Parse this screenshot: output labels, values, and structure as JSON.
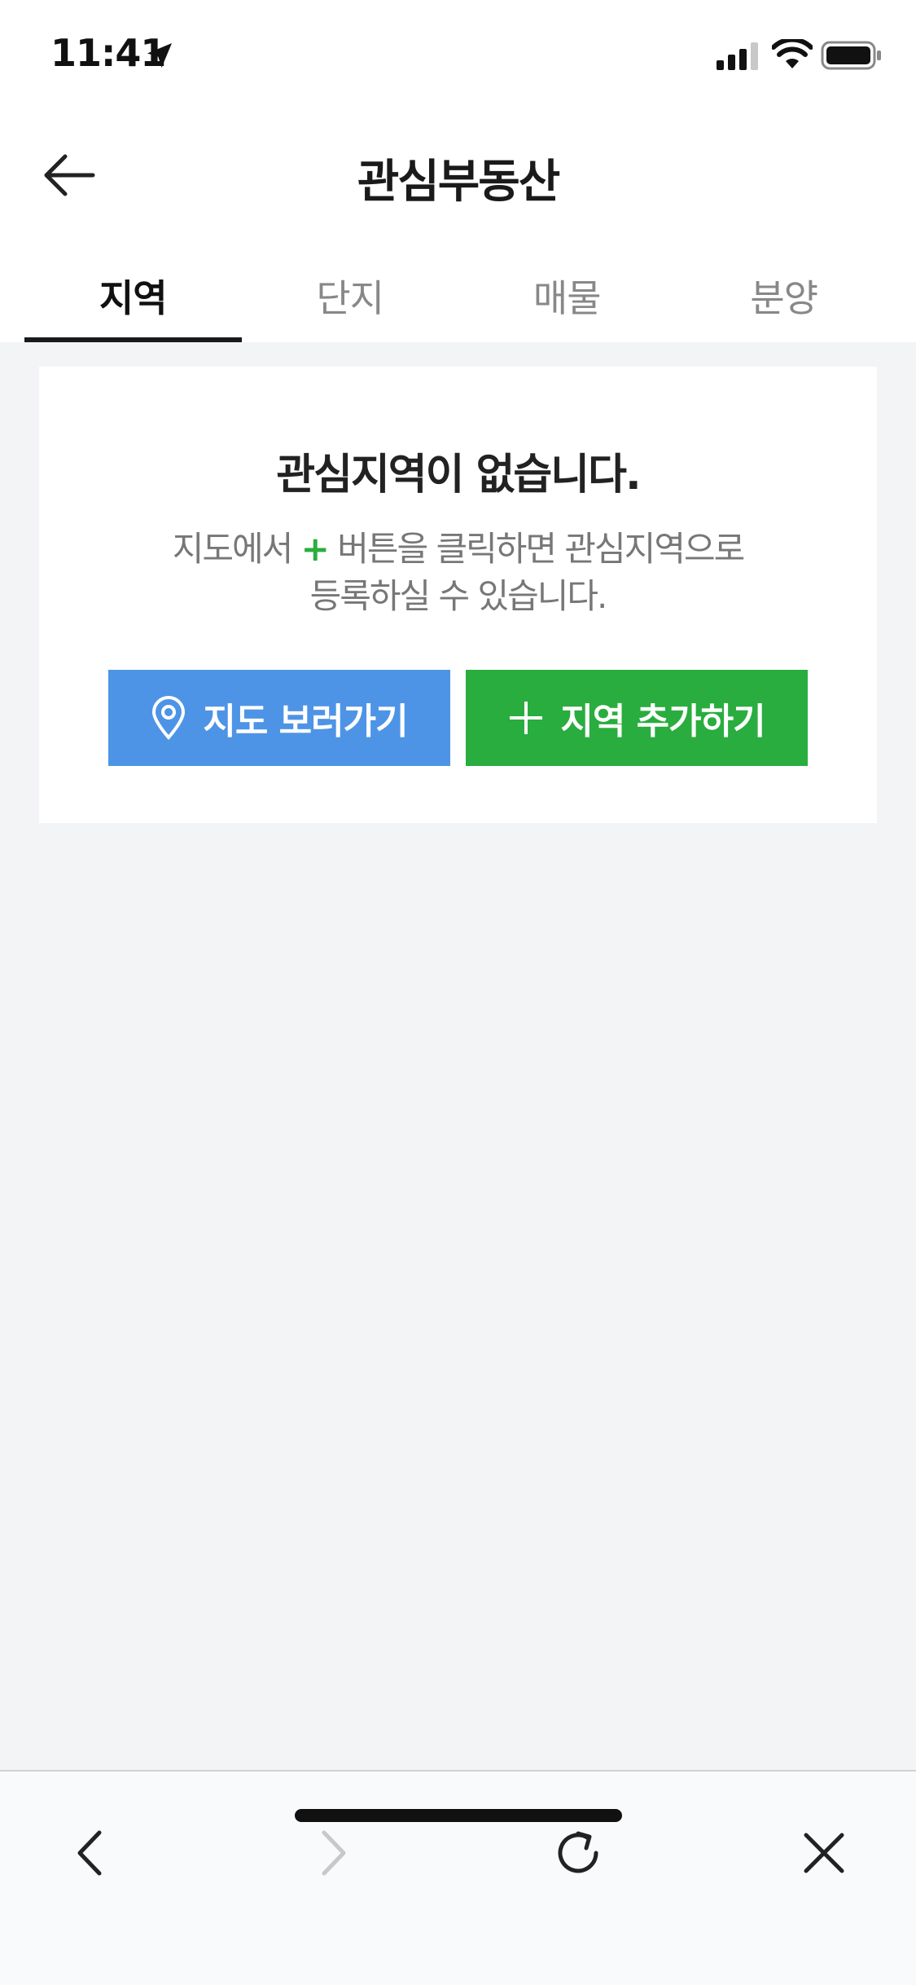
{
  "status_bar": {
    "time": "11:41",
    "icons": [
      "location-arrow-icon",
      "signal-icon",
      "wifi-icon",
      "battery-icon"
    ]
  },
  "header": {
    "title": "관심부동산",
    "back_icon": "arrow-left-icon"
  },
  "tabs": [
    {
      "label": "지역",
      "active": true
    },
    {
      "label": "단지",
      "active": false
    },
    {
      "label": "매물",
      "active": false
    },
    {
      "label": "분양",
      "active": false
    }
  ],
  "empty_state": {
    "title": "관심지역이 없습니다.",
    "desc_before": "지도에서 ",
    "desc_plus": "+",
    "desc_after": " 버튼을 클릭하면 관심지역으로",
    "desc_line2": "등록하실 수 있습니다.",
    "map_button": "지도 보러가기",
    "add_button": "지역 추가하기"
  },
  "browser_bar": {
    "icons": [
      "chevron-left-icon",
      "chevron-right-icon",
      "reload-icon",
      "close-icon"
    ]
  },
  "colors": {
    "map_button": "#4e94e6",
    "add_button": "#29ad3e",
    "background": "#f3f4f6"
  }
}
